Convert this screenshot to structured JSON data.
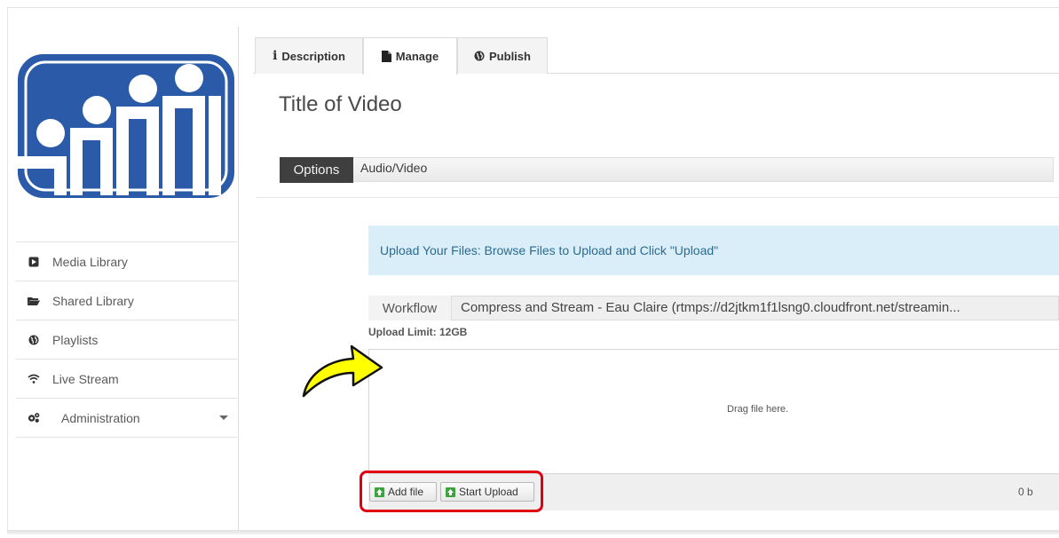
{
  "sidebar": {
    "logo_name": "site-logo",
    "items": [
      {
        "label": "Media Library",
        "icon": "play-square-icon"
      },
      {
        "label": "Shared Library",
        "icon": "folder-open-icon"
      },
      {
        "label": "Playlists",
        "icon": "globe-icon"
      },
      {
        "label": "Live Stream",
        "icon": "wifi-icon"
      },
      {
        "label": "Administration",
        "icon": "gears-icon"
      }
    ]
  },
  "tabs": [
    {
      "label": "Description",
      "icon": "info-icon"
    },
    {
      "label": "Manage",
      "icon": "file-icon"
    },
    {
      "label": "Publish",
      "icon": "globe-icon"
    }
  ],
  "main": {
    "title": "Title of Video",
    "options_button": "Options",
    "audio_video_link": "Audio/Video",
    "upload_message": "Upload Your Files: Browse Files to Upload and Click \"Upload\"",
    "workflow_label": "Workflow",
    "workflow_value": "Compress and Stream - Eau Claire (rtmps://d2jtkm1f1lsng0.cloudfront.net/streamin...",
    "upload_limit": "Upload Limit: 12GB",
    "drop_text": "Drag file here.",
    "add_file_label": "Add file",
    "start_upload_label": "Start Upload",
    "total_size": "0 b"
  },
  "colors": {
    "logo_blue": "#2a5aa8",
    "alert_bg": "#d9eef8",
    "alert_text": "#2b6b8f",
    "highlight_red": "#e00012",
    "annotation_yellow": "#ffff00",
    "upload_arrow_green": "#3da23d"
  }
}
